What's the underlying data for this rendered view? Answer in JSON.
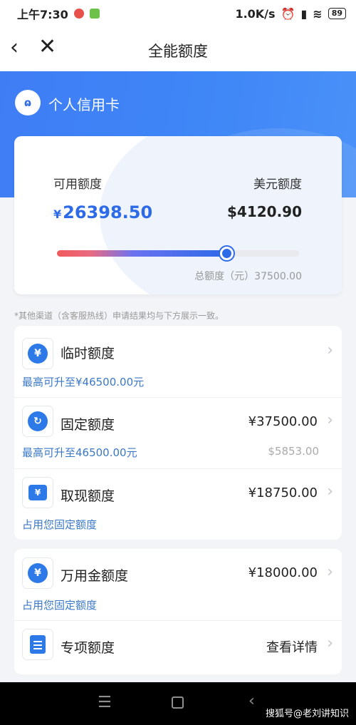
{
  "status_bar": {
    "time": "上午7:30",
    "network": "1.0K/s",
    "battery": "89"
  },
  "nav": {
    "back_icon": "chevron-left-icon",
    "close_icon": "close-icon",
    "title": "全能额度"
  },
  "card": {
    "name": "个人信用卡",
    "available_label": "可用额度",
    "available_currency": "¥",
    "available_value": "26398.50",
    "usd_label": "美元额度",
    "usd_value": "$4120.90",
    "usage_fraction": 0.7,
    "total_text": "总额度（元）37500.00"
  },
  "note": "*其他渠道（含客服热线）申请结果均与下方展示一致。",
  "limits": [
    {
      "name": "临时额度",
      "amount": "",
      "sub": "最高可升至¥46500.00元",
      "sub_right": ""
    },
    {
      "name": "固定额度",
      "amount": "¥37500.00",
      "sub": "最高可升至46500.00元",
      "sub_right": "$5853.00"
    },
    {
      "name": "取现额度",
      "amount": "¥18750.00",
      "sub": "占用您固定额度",
      "sub_right": ""
    }
  ],
  "limits2": [
    {
      "name": "万用金额度",
      "amount": "¥18000.00",
      "sub": "占用您固定额度"
    },
    {
      "name": "专项额度",
      "amount": "查看详情",
      "sub": ""
    }
  ],
  "colors": {
    "brand_blue": "#2d6ae8",
    "header_blue": "#3f7df5",
    "link_blue": "#3a78c8"
  },
  "watermark": "搜狐号@老刘讲知识"
}
